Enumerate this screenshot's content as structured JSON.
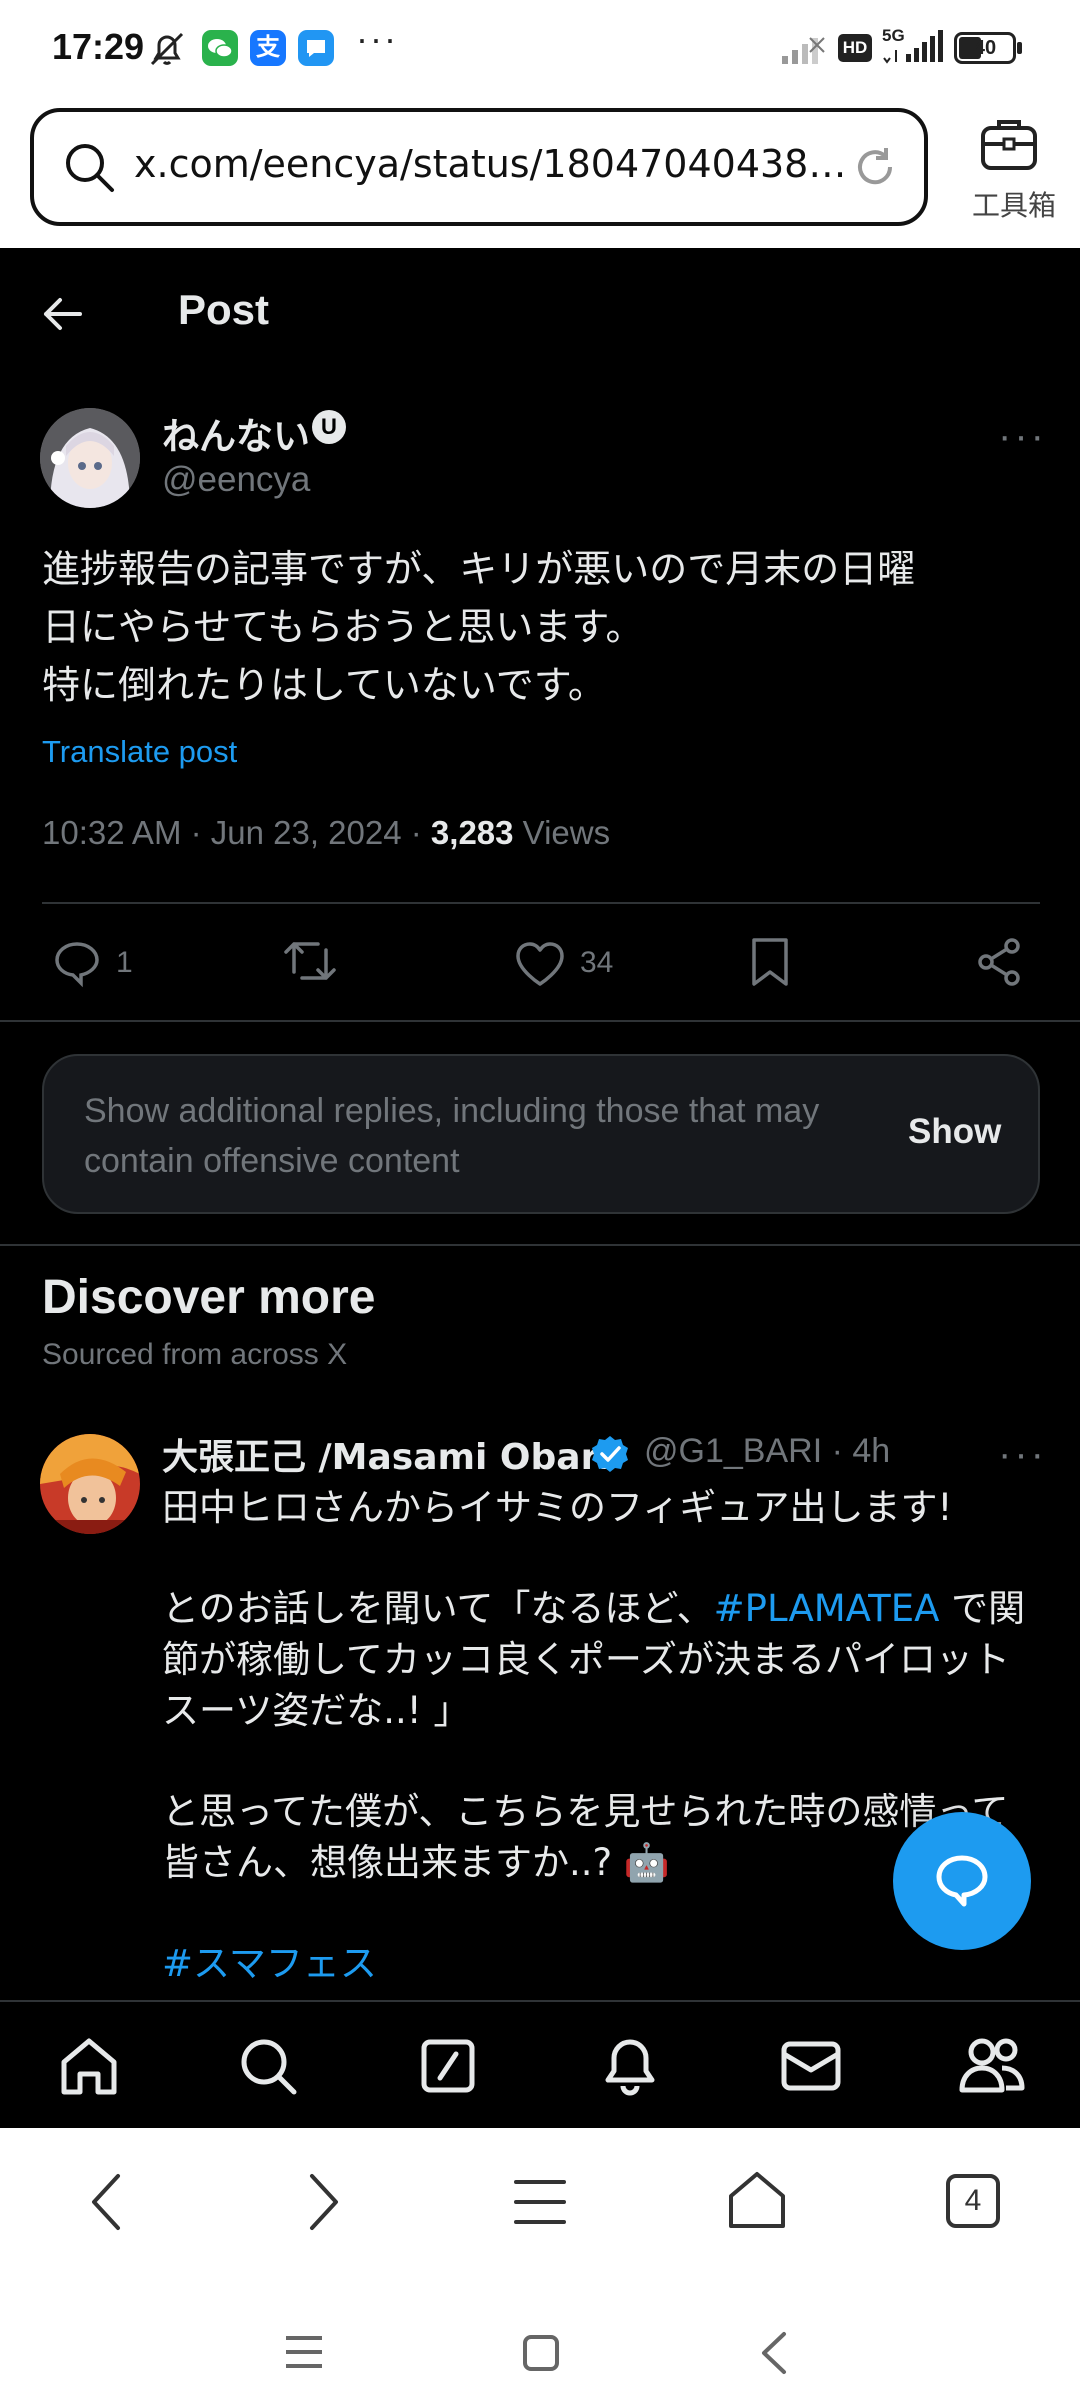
{
  "status_bar": {
    "time": "17:29",
    "battery": "40",
    "network_label": "5G",
    "hd_label": "HD"
  },
  "address_bar": {
    "url": "x.com/eencya/status/180470404389...",
    "toolbox_label": "工具箱"
  },
  "header": {
    "title": "Post"
  },
  "post": {
    "display_name": "ねんない",
    "badge": "U",
    "handle": "@eencya",
    "text_lines": [
      "進捗報告の記事ですが、キリが悪いので月末の日曜",
      "日にやらせてもらおうと思います。",
      "特に倒れたりはしていないです。"
    ],
    "translate": "Translate post",
    "time": "10:32 AM · Jun 23, 2024 · ",
    "views_count": "3,283",
    "views_label": " Views",
    "reply_count": "1",
    "like_count": "34"
  },
  "show_replies": {
    "text": "Show additional replies, including those that may contain offensive content",
    "button": "Show"
  },
  "discover": {
    "title": "Discover more",
    "subtitle": "Sourced from across X"
  },
  "tweet2": {
    "display_name": "大張正己 /Masami Obari",
    "handle_time": "@G1_BARI · 4h",
    "line1": "田中ヒロさんからイサミのフィギュア出します!",
    "line2_pre": "とのお話しを聞いて「なるほど、",
    "hashtag1": "#PLAMATEA",
    "line2_post": " で関",
    "line3": "節が稼働してカッコ良くポーズが決まるパイロット",
    "line4": "スーツ姿だな..! 」",
    "line5": "と思ってた僕が、こちらを見せられた時の感情って",
    "line6": "皆さん、想像出来ますか..? 🤖",
    "hashtag2": "#スマフェス"
  },
  "browser": {
    "tab_count": "4"
  },
  "colors": {
    "accent": "#1d9bf0",
    "background": "#000000",
    "muted": "#71767b",
    "divider": "#2f3336"
  }
}
